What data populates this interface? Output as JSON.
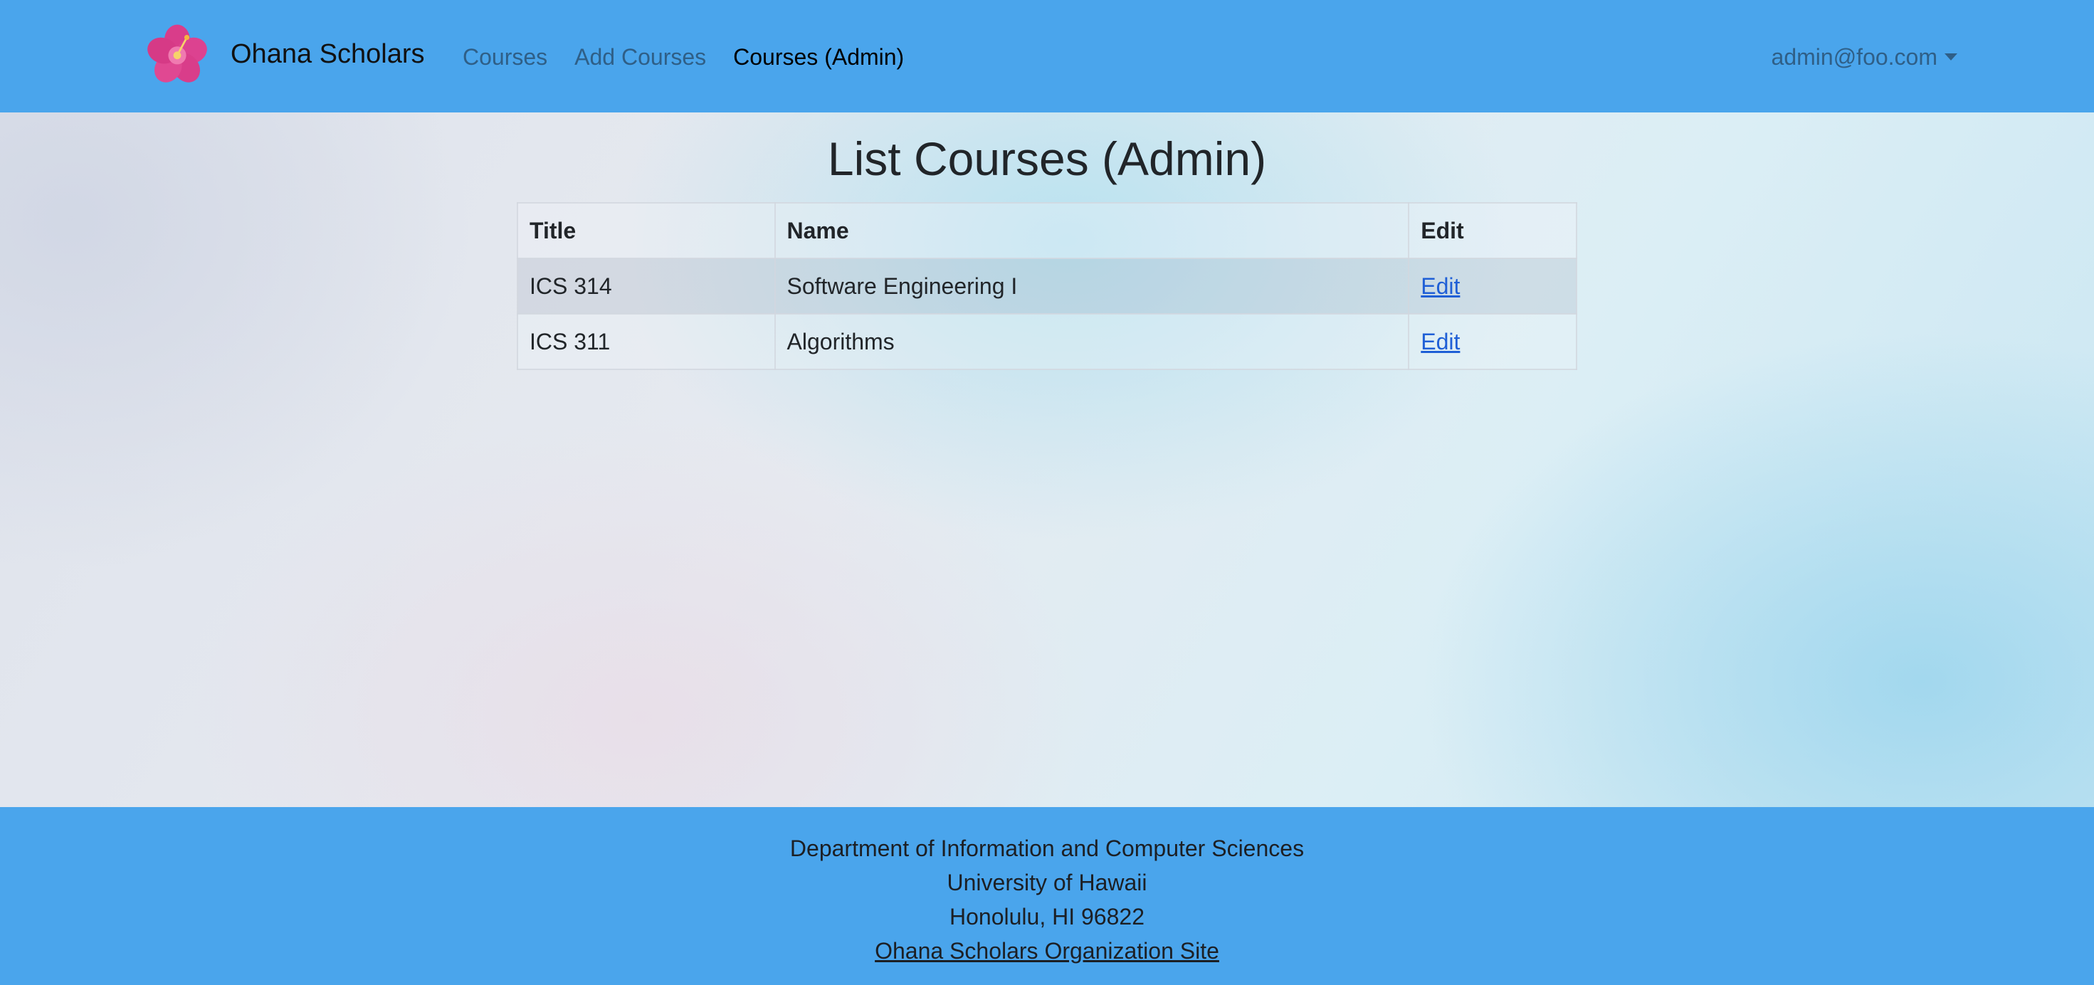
{
  "navbar": {
    "brand_name": "Ohana Scholars",
    "logo_icon": "hibiscus-flower-icon",
    "links": [
      {
        "label": "Courses",
        "active": false
      },
      {
        "label": "Add Courses",
        "active": false
      },
      {
        "label": "Courses (Admin)",
        "active": true
      }
    ],
    "user_email": "admin@foo.com",
    "background_color": "#4aa5ec"
  },
  "main": {
    "title": "List Courses (Admin)",
    "table": {
      "headers": [
        "Title",
        "Name",
        "Edit"
      ],
      "rows": [
        {
          "title": "ICS 314",
          "name": "Software Engineering I",
          "edit": "Edit"
        },
        {
          "title": "ICS 311",
          "name": "Algorithms",
          "edit": "Edit"
        }
      ]
    }
  },
  "footer": {
    "line1": "Department of Information and Computer Sciences",
    "line2": "University of Hawaii",
    "line3": "Honolulu, HI 96822",
    "link_label": "Ohana Scholars Organization Site"
  },
  "colors": {
    "accent": "#4aa5ec",
    "link": "#1f5fd6"
  }
}
